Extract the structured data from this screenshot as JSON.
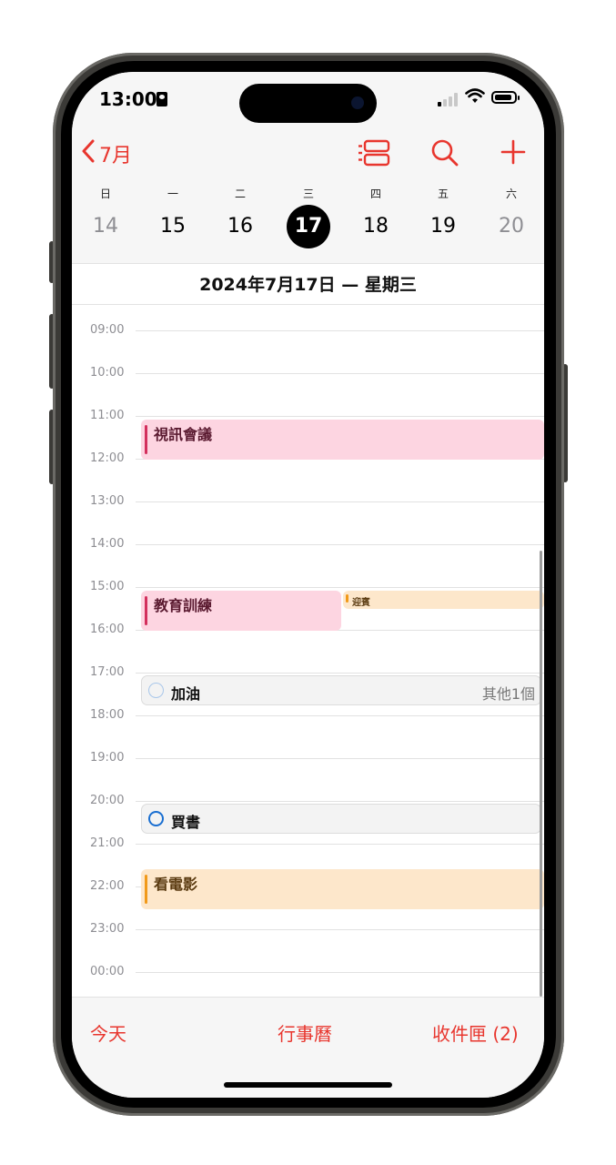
{
  "status": {
    "time": "13:00"
  },
  "nav": {
    "back_label": "7月"
  },
  "week": {
    "weekdays": [
      "日",
      "一",
      "二",
      "三",
      "四",
      "五",
      "六"
    ],
    "dates": [
      "14",
      "15",
      "16",
      "17",
      "18",
      "19",
      "20"
    ],
    "selected_index": 3
  },
  "day_title": "2024年7月17日 — 星期三",
  "hours": [
    "09:00",
    "10:00",
    "11:00",
    "12:00",
    "13:00",
    "14:00",
    "15:00",
    "16:00",
    "17:00",
    "18:00",
    "19:00",
    "20:00",
    "21:00",
    "22:00",
    "23:00",
    "00:00"
  ],
  "events": [
    {
      "title": "視訊會議",
      "color": "pink"
    },
    {
      "title": "教育訓練",
      "color": "pink"
    },
    {
      "title": "迎賓",
      "color": "orange"
    },
    {
      "title": "看電影",
      "color": "orange"
    }
  ],
  "reminders": [
    {
      "title": "加油",
      "more": "其他1個"
    },
    {
      "title": "買書",
      "more": ""
    }
  ],
  "tabs": {
    "today": "今天",
    "calendars": "行事曆",
    "inbox": "收件匣 (2)"
  },
  "colors": {
    "accent": "#e8362e",
    "pink_event": "#fdd5e1",
    "orange_event": "#fde7cb"
  }
}
